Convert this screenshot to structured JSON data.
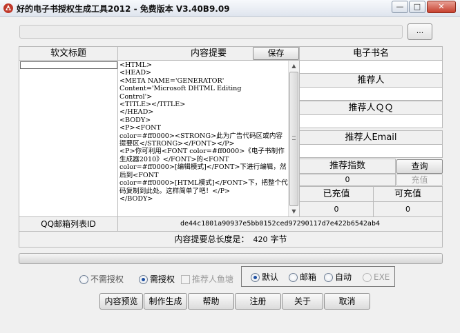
{
  "window": {
    "title": "好的电子书授权生成工具2012 - 免费版本 V3.40B9.09",
    "icons": {
      "app": "app-logo-icon",
      "minimize": "minimize-icon",
      "maximize": "maximize-icon",
      "close": "close-icon"
    }
  },
  "top": {
    "path_value": "",
    "browse_label": "..."
  },
  "columns": {
    "title_header": "软文标题",
    "summary_header": "内容提要",
    "save_label": "保存"
  },
  "summary": {
    "content": "<HTML>\n<HEAD>\n<META NAME='GENERATOR'\nContent='Microsoft DHTML Editing\nControl'>\n<TITLE></TITLE>\n</HEAD>\n<BODY>\n<P><FONT\ncolor=#ff0000><STRONG>此为广告代码区或内容提要区</STRONG></FONT></P>\n<P>你可利用<FONT color=#ff0000>《电子书制作生成器2010》</FONT>的<FONT\ncolor=#ff0000>[编辑模式]</FONT>下进行编辑，然后到<FONT\ncolor=#ff0000>[HTML模式]</FONT>下，把整个代码复制到此处。这样简单了吧！</P>\n</BODY>"
  },
  "right_panel": {
    "ebook_name_label": "电子书名",
    "referrer_label": "推荐人",
    "referrer_qq_label": "推荐人ＱＱ",
    "referrer_email_label": "推荐人Email",
    "recommend_index_label": "推荐指数",
    "query_label": "查询",
    "recommend_index_value": "0",
    "recharge_label": "充值",
    "charged_label": "已充值",
    "rechargeable_label": "可充值",
    "charged_value": "0",
    "rechargeable_value": "0"
  },
  "bottom": {
    "qq_list_label": "QQ邮箱列表ID",
    "id_value": "de44c1801a90937e5bb0152ced97290117d7e422b6542ab4",
    "length_label": "内容提要总长度是：",
    "length_value": "420",
    "length_unit": "字节",
    "progress": 0
  },
  "options": {
    "no_auth": "不需授权",
    "need_auth": "需授权",
    "referrer_pond": "推荐人鱼塘",
    "default": "默认",
    "mailbox": "邮箱",
    "auto": "自动",
    "exe": "EXE"
  },
  "buttons": {
    "preview": "内容预览",
    "make": "制作生成",
    "help": "帮助",
    "register": "注册",
    "about": "关于",
    "cancel": "取消"
  },
  "colors": {
    "accent": "#1d4fa3",
    "close_button": "#c7402e"
  }
}
